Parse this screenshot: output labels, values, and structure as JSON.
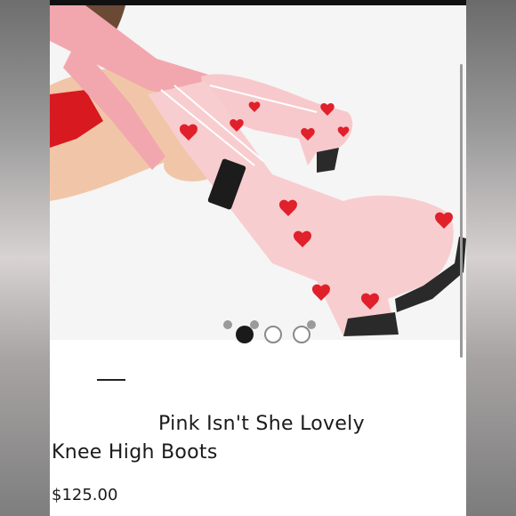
{
  "product": {
    "title_line1": "Pink Isn't She Lovely",
    "title_line2": "Knee High Boots",
    "price": "$125.00"
  },
  "carousel": {
    "image_count": 4,
    "active_index": 0
  },
  "colors": {
    "boot_pink": "#f7c9cc",
    "heart_red": "#e0202a",
    "text": "#1a1a1a",
    "sleeve_pink": "#f2a7ae",
    "shorts_red": "#d8191f"
  }
}
